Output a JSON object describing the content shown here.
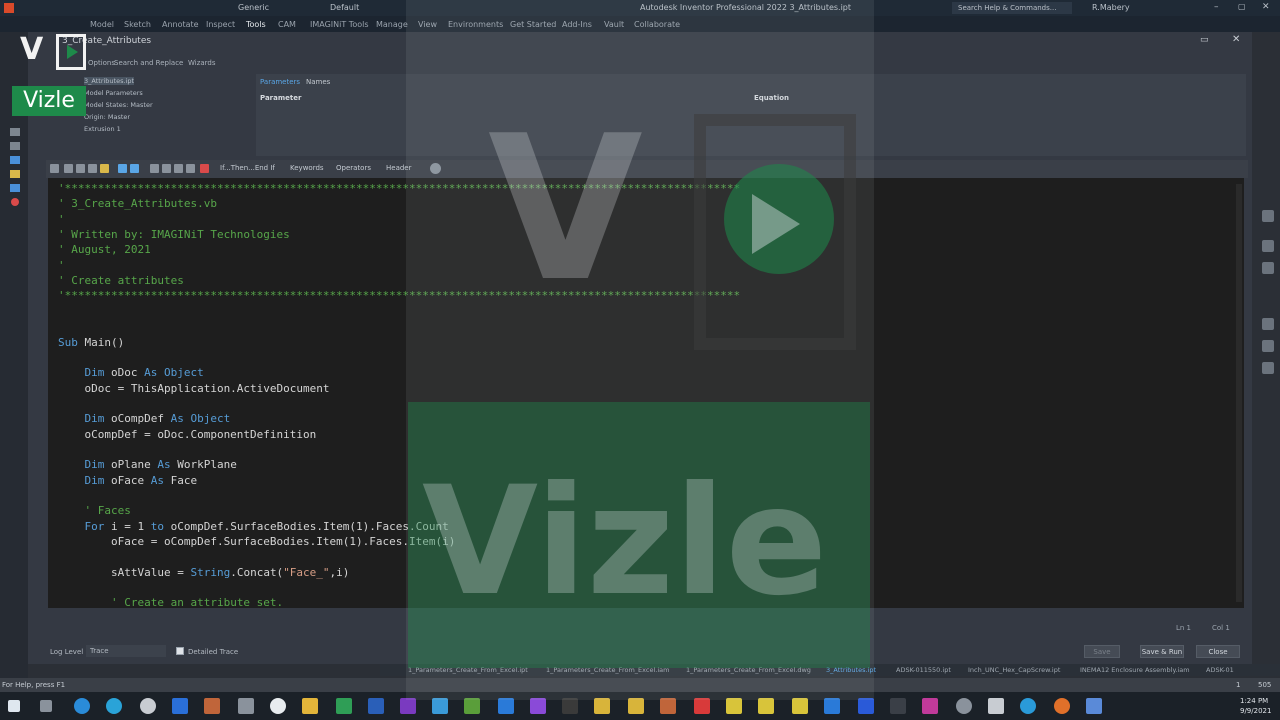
{
  "window": {
    "title": "Autodesk Inventor Professional 2022   3_Attributes.ipt",
    "search_placeholder": "Search Help & Commands...",
    "user": "R.Mabery",
    "workspace": "Generic",
    "appearance": "Default"
  },
  "ribbon_tabs": [
    "Model",
    "Sketch",
    "Annotate",
    "Inspect",
    "Tools",
    "CAM",
    "IMAGINiT Tools",
    "Manage",
    "View",
    "Environments",
    "Get Started",
    "Add-Ins",
    "Vault",
    "Collaborate"
  ],
  "dialog": {
    "title": "3_Create_Attributes",
    "tabs": [
      "Options",
      "Search and Replace",
      "Wizards"
    ],
    "tree_items": [
      "3_Attributes.ipt",
      "Model Parameters",
      "Model States: Master",
      "Origin: Master",
      "Extrusion 1"
    ],
    "param_tabs": [
      "Parameters",
      "Names"
    ],
    "param_columns": [
      "Parameter",
      "Equation"
    ]
  },
  "editor_toolbar": {
    "items": [
      "If...Then...End If",
      "Keywords",
      "Operators",
      "Header"
    ]
  },
  "code_lines": [
    {
      "cls": "c-comment",
      "text": "'******************************************************************************************************"
    },
    {
      "cls": "c-comment",
      "text": "' 3_Create_Attributes.vb"
    },
    {
      "cls": "c-comment",
      "text": "'"
    },
    {
      "cls": "c-comment",
      "text": "' Written by: IMAGINiT Technologies"
    },
    {
      "cls": "c-comment",
      "text": "' August, 2021"
    },
    {
      "cls": "c-comment",
      "text": "'"
    },
    {
      "cls": "c-comment",
      "text": "' Create attributes"
    },
    {
      "cls": "c-comment",
      "text": "'******************************************************************************************************"
    },
    {
      "cls": "c-plain",
      "text": ""
    },
    {
      "cls": "c-plain",
      "text": ""
    },
    {
      "cls": "mixed",
      "parts": [
        {
          "c": "c-kw",
          "t": "Sub "
        },
        {
          "c": "c-plain",
          "t": "Main()"
        }
      ]
    },
    {
      "cls": "c-plain",
      "text": ""
    },
    {
      "cls": "mixed",
      "parts": [
        {
          "c": "c-plain",
          "t": "    "
        },
        {
          "c": "c-kw",
          "t": "Dim "
        },
        {
          "c": "c-plain",
          "t": "oDoc "
        },
        {
          "c": "c-kw",
          "t": "As Object"
        }
      ]
    },
    {
      "cls": "c-plain",
      "text": "    oDoc = ThisApplication.ActiveDocument"
    },
    {
      "cls": "c-plain",
      "text": ""
    },
    {
      "cls": "mixed",
      "parts": [
        {
          "c": "c-plain",
          "t": "    "
        },
        {
          "c": "c-kw",
          "t": "Dim "
        },
        {
          "c": "c-plain",
          "t": "oCompDef "
        },
        {
          "c": "c-kw",
          "t": "As Object"
        }
      ]
    },
    {
      "cls": "c-plain",
      "text": "    oCompDef = oDoc.ComponentDefinition"
    },
    {
      "cls": "c-plain",
      "text": ""
    },
    {
      "cls": "mixed",
      "parts": [
        {
          "c": "c-plain",
          "t": "    "
        },
        {
          "c": "c-kw",
          "t": "Dim "
        },
        {
          "c": "c-plain",
          "t": "oPlane "
        },
        {
          "c": "c-kw",
          "t": "As "
        },
        {
          "c": "c-plain",
          "t": "WorkPlane"
        }
      ]
    },
    {
      "cls": "mixed",
      "parts": [
        {
          "c": "c-plain",
          "t": "    "
        },
        {
          "c": "c-kw",
          "t": "Dim "
        },
        {
          "c": "c-plain",
          "t": "oFace "
        },
        {
          "c": "c-kw",
          "t": "As "
        },
        {
          "c": "c-plain",
          "t": "Face"
        }
      ]
    },
    {
      "cls": "c-plain",
      "text": ""
    },
    {
      "cls": "mixed",
      "parts": [
        {
          "c": "c-plain",
          "t": "    "
        },
        {
          "c": "c-comment",
          "t": "' Faces"
        }
      ]
    },
    {
      "cls": "mixed",
      "parts": [
        {
          "c": "c-plain",
          "t": "    "
        },
        {
          "c": "c-kw",
          "t": "For "
        },
        {
          "c": "c-plain",
          "t": "i = 1 "
        },
        {
          "c": "c-kw",
          "t": "to "
        },
        {
          "c": "c-plain",
          "t": "oCompDef.SurfaceBodies.Item(1).Faces.Count"
        }
      ]
    },
    {
      "cls": "c-plain",
      "text": "        oFace = oCompDef.SurfaceBodies.Item(1).Faces.Item(i)"
    },
    {
      "cls": "c-plain",
      "text": ""
    },
    {
      "cls": "mixed",
      "parts": [
        {
          "c": "c-plain",
          "t": "        sAttValue = "
        },
        {
          "c": "c-kw",
          "t": "String"
        },
        {
          "c": "c-plain",
          "t": ".Concat("
        },
        {
          "c": "c-str",
          "t": "\"Face_\""
        },
        {
          "c": "c-plain",
          "t": ",i)"
        }
      ]
    },
    {
      "cls": "c-plain",
      "text": ""
    },
    {
      "cls": "mixed",
      "parts": [
        {
          "c": "c-plain",
          "t": "        "
        },
        {
          "c": "c-comment",
          "t": "' Create an attribute set."
        }
      ]
    }
  ],
  "editor_status": {
    "line": "Ln 1",
    "col": "Col 1"
  },
  "bottom": {
    "log_level_label": "Log Level",
    "log_level_value": "Trace",
    "detailed_trace": "Detailed Trace",
    "save": "Save",
    "save_run": "Save & Run",
    "close": "Close"
  },
  "doc_tabs": [
    "1_Parameters_Create_From_Excel.ipt",
    "1_Parameters_Create_From_Excel.iam",
    "1_Parameters_Create_From_Excel.dwg",
    "3_Attributes.ipt",
    "ADSK-011550.ipt",
    "Inch_UNC_Hex_CapScrew.ipt",
    "INEMA12 Enclosure Assembly.iam",
    "ADSK-01"
  ],
  "statusline": {
    "help": "For Help, press F1",
    "count1": "1",
    "count2": "505"
  },
  "clock": {
    "time": "1:24 PM",
    "date": "9/9/2021"
  },
  "watermark": {
    "brand": "Vizle",
    "accent": "#1e8a4a"
  }
}
